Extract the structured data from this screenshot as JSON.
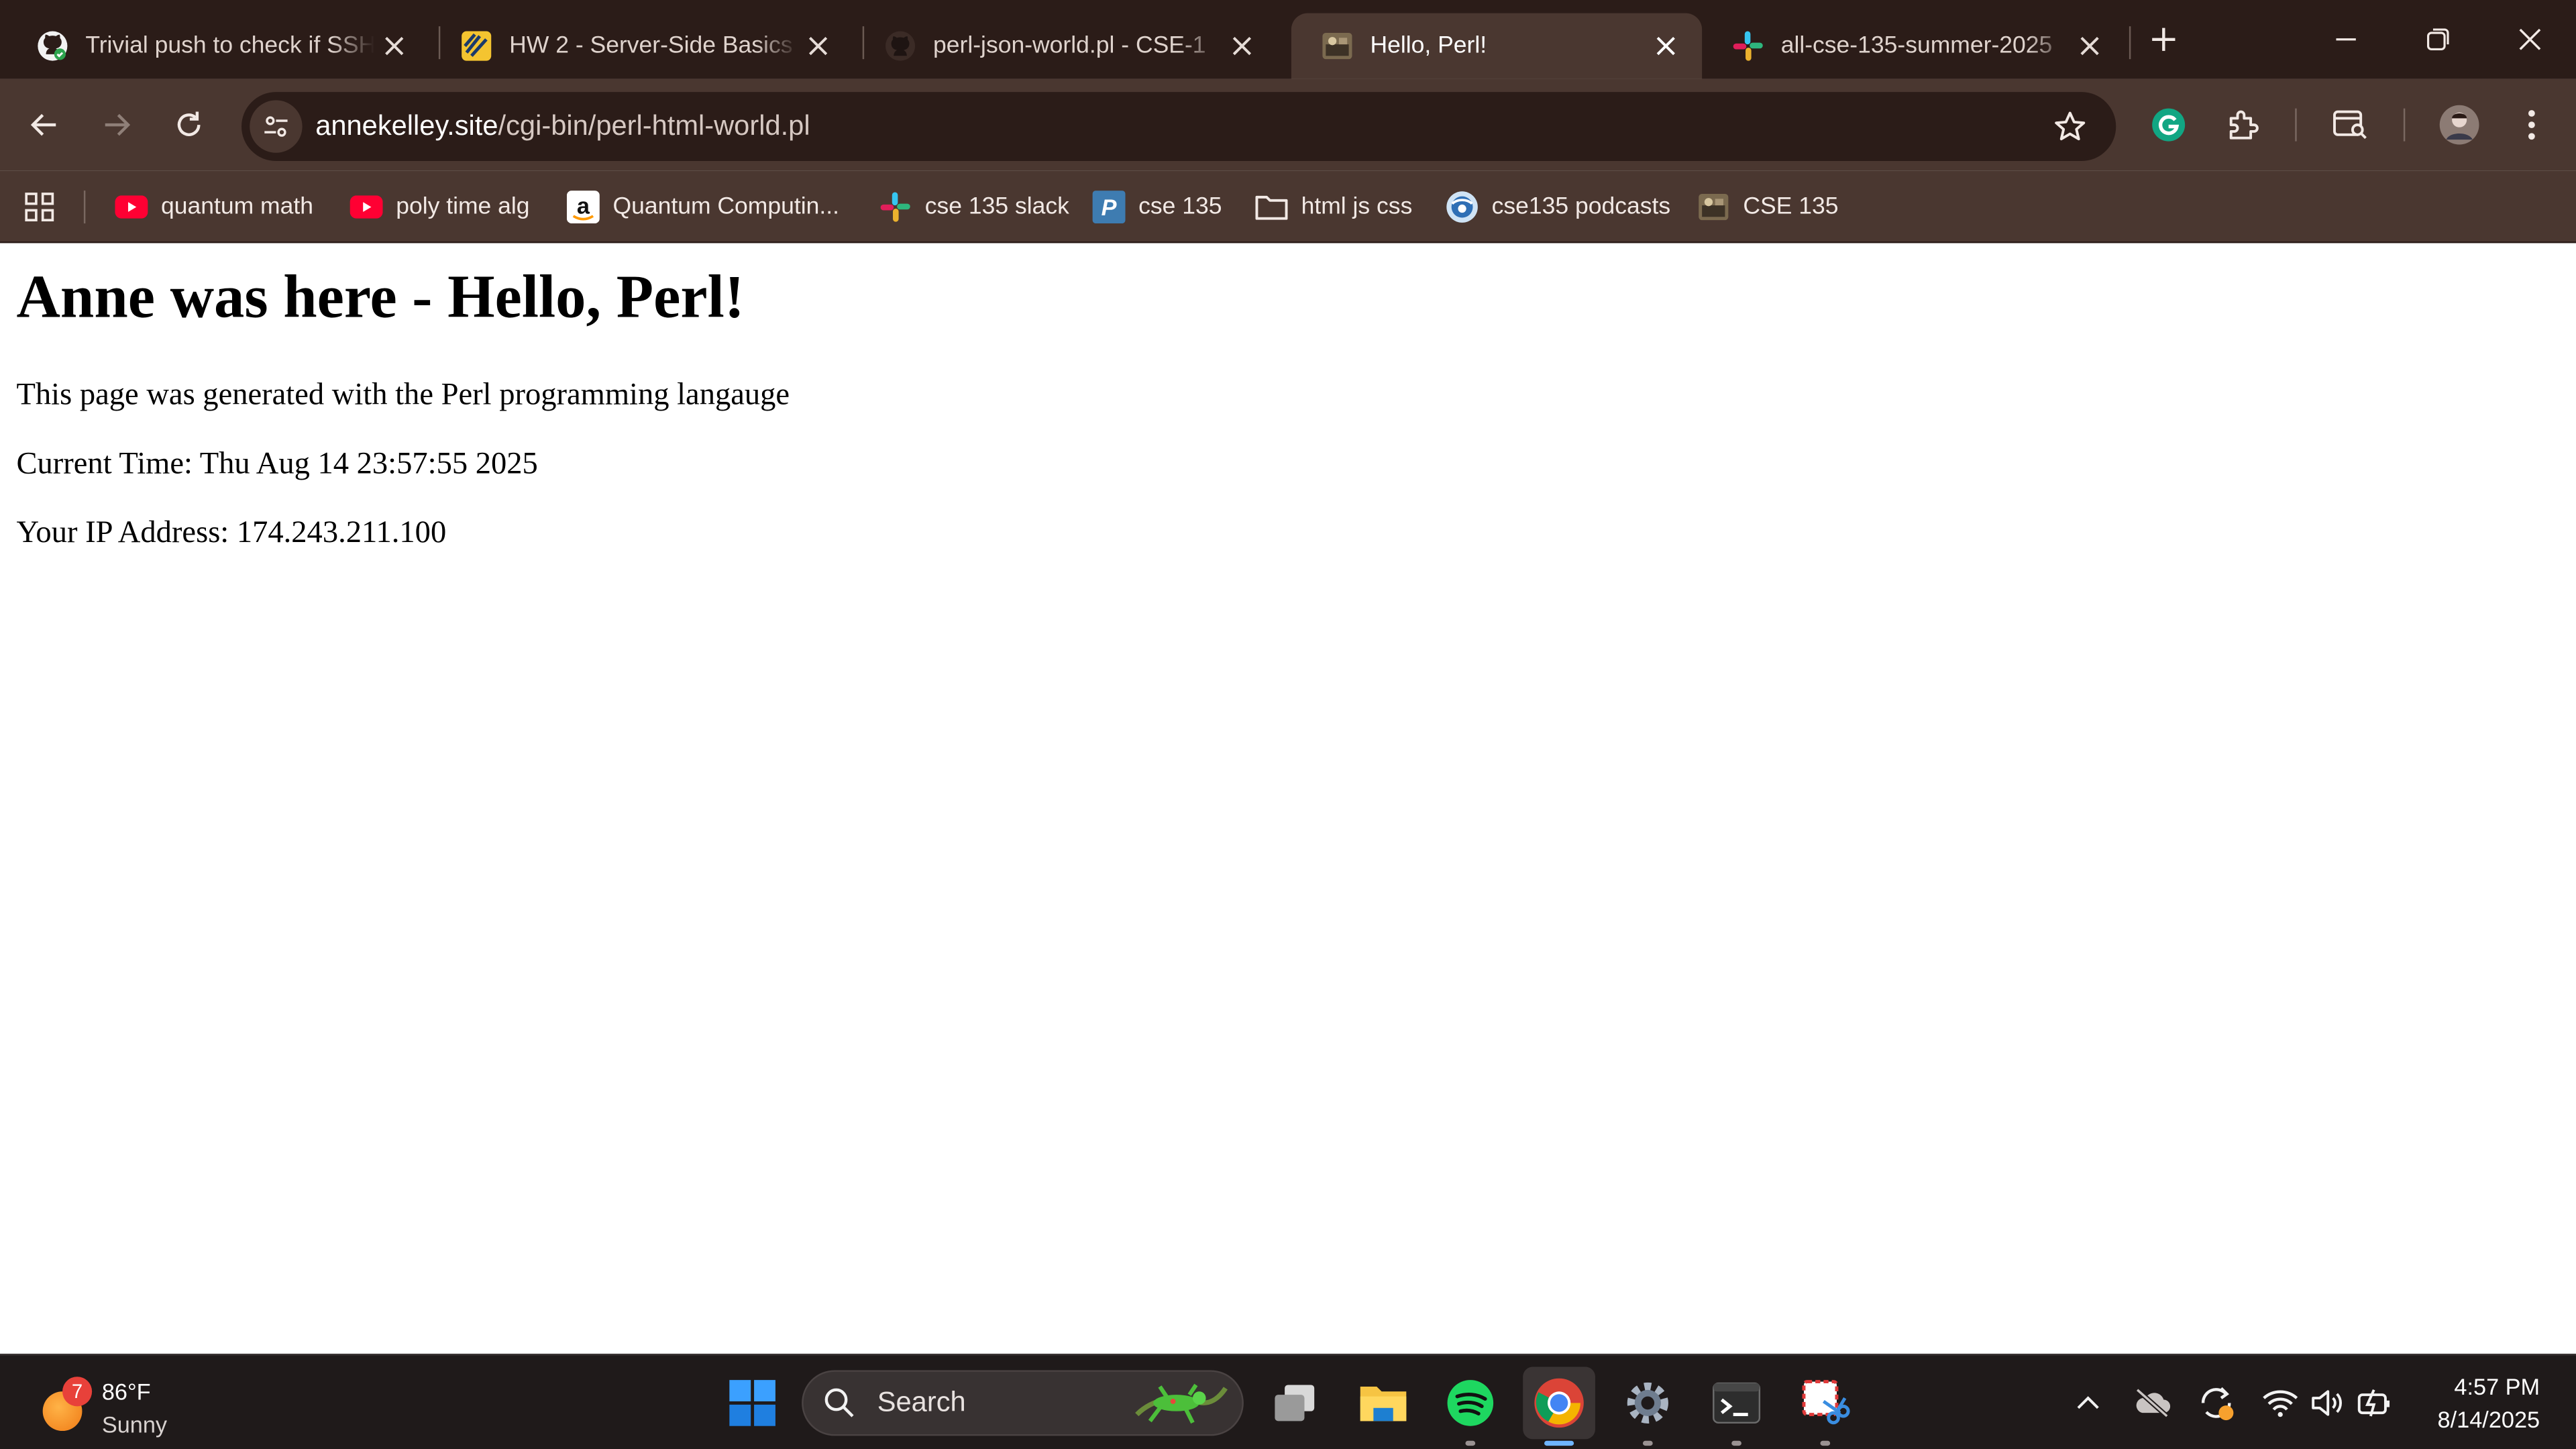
{
  "tabs": [
    {
      "title": "Trivial push to check if SSH",
      "icon": "github-icon",
      "active": false
    },
    {
      "title": "HW 2 - Server-Side Basics",
      "icon": "canvas-icon",
      "active": false
    },
    {
      "title": "perl-json-world.pl - CSE-1",
      "icon": "github-icon",
      "active": false
    },
    {
      "title": "Hello, Perl!",
      "icon": "site-thumbnail-icon",
      "active": true
    },
    {
      "title": "all-cse-135-summer-2025",
      "icon": "slack-icon",
      "active": false
    }
  ],
  "address_bar": {
    "domain": "annekelley.site",
    "path": "/cgi-bin/perl-html-world.pl"
  },
  "bookmarks": [
    {
      "label": "quantum math",
      "icon": "youtube-icon"
    },
    {
      "label": "poly time alg",
      "icon": "youtube-icon"
    },
    {
      "label": "Quantum Computin...",
      "icon": "amazon-icon"
    },
    {
      "label": "cse 135 slack",
      "icon": "slack-icon"
    },
    {
      "label": "cse 135",
      "icon": "piazza-icon"
    },
    {
      "label": "html js css",
      "icon": "folder-icon"
    },
    {
      "label": "cse135 podcasts",
      "icon": "podcast-icon"
    },
    {
      "label": "CSE 135",
      "icon": "site-thumbnail-icon"
    }
  ],
  "page": {
    "heading": "Anne was here - Hello, Perl!",
    "generated_text": "This page was generated with the Perl programming langauge",
    "time_text": "Current Time: Thu Aug 14 23:57:55 2025",
    "ip_text": "Your IP Address: 174.243.211.100"
  },
  "taskbar": {
    "weather": {
      "badge": "7",
      "temp": "86°F",
      "condition": "Sunny"
    },
    "search_placeholder": "Search",
    "clock": {
      "time": "4:57 PM",
      "date": "8/14/2025"
    }
  },
  "colors": {
    "tab_strip": "#2b1c18",
    "toolbar": "#4a3730",
    "taskbar": "#1f1a1a",
    "accent": "#6fb5ff"
  }
}
